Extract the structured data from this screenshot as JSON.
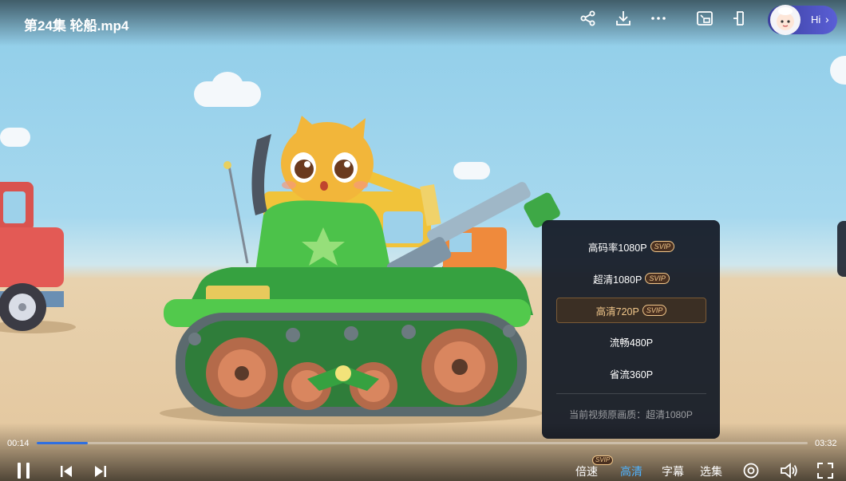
{
  "player": {
    "title": "第24集 轮船.mp4",
    "hi_label": "Hi"
  },
  "top_icons": [
    "share-icon",
    "download-icon",
    "more-icon",
    "picture-in-picture-icon",
    "popout-icon"
  ],
  "quality_menu": {
    "items": [
      {
        "label": "高码率1080P",
        "badge": "SVIP",
        "active": false
      },
      {
        "label": "超清1080P",
        "badge": "SVIP",
        "active": false
      },
      {
        "label": "高清720P",
        "badge": "SVIP",
        "active": true
      },
      {
        "label": "流畅480P",
        "badge": "",
        "active": false
      },
      {
        "label": "省流360P",
        "badge": "",
        "active": false
      }
    ],
    "note": "当前视频原画质：超清1080P"
  },
  "controls": {
    "current_time": "00:14",
    "duration": "03:32",
    "progress_fraction": 0.066,
    "speed_label": "倍速",
    "speed_badge": "SVIP",
    "quality_label": "高清",
    "subtitle_label": "字幕",
    "episodes_label": "选集"
  },
  "colors": {
    "accent": "#4fb3ff",
    "progress": "#2f6fe0",
    "svip_gold": "#f0c68a"
  }
}
